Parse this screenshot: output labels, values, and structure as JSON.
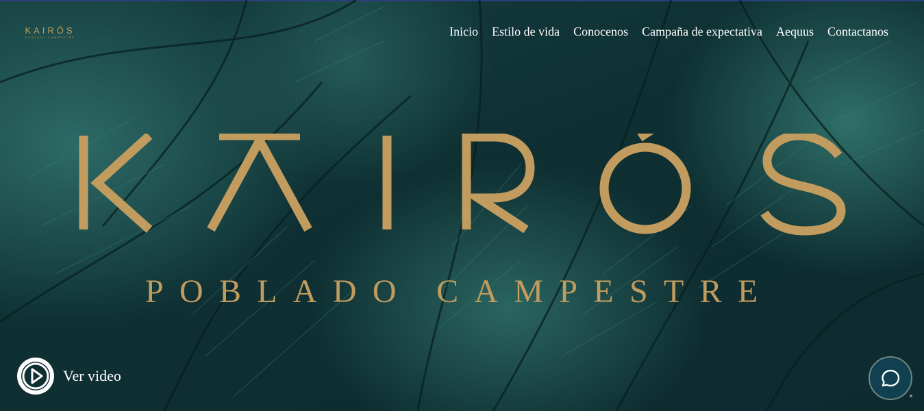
{
  "brand": {
    "small_logo_word": "KAIRÓS",
    "small_logo_sub": "POBLADO CAMPESTRE",
    "hero_title": "KAIRÓS",
    "hero_subtitle": "POBLADO CAMPESTRE"
  },
  "nav": {
    "items": [
      {
        "label": "Inicio"
      },
      {
        "label": "Estilo de vida"
      },
      {
        "label": "Conocenos"
      },
      {
        "label": "Campaña de expectativa"
      },
      {
        "label": "Aequus"
      },
      {
        "label": "Contactanos"
      }
    ]
  },
  "video": {
    "label": "Ver video",
    "icon": "play-icon"
  },
  "chat": {
    "icon": "chat-bubble-icon"
  },
  "colors": {
    "gold": "#c29c5e",
    "background": "#0f3033",
    "nav_text": "#ffffff",
    "chat_button": "#114050"
  }
}
